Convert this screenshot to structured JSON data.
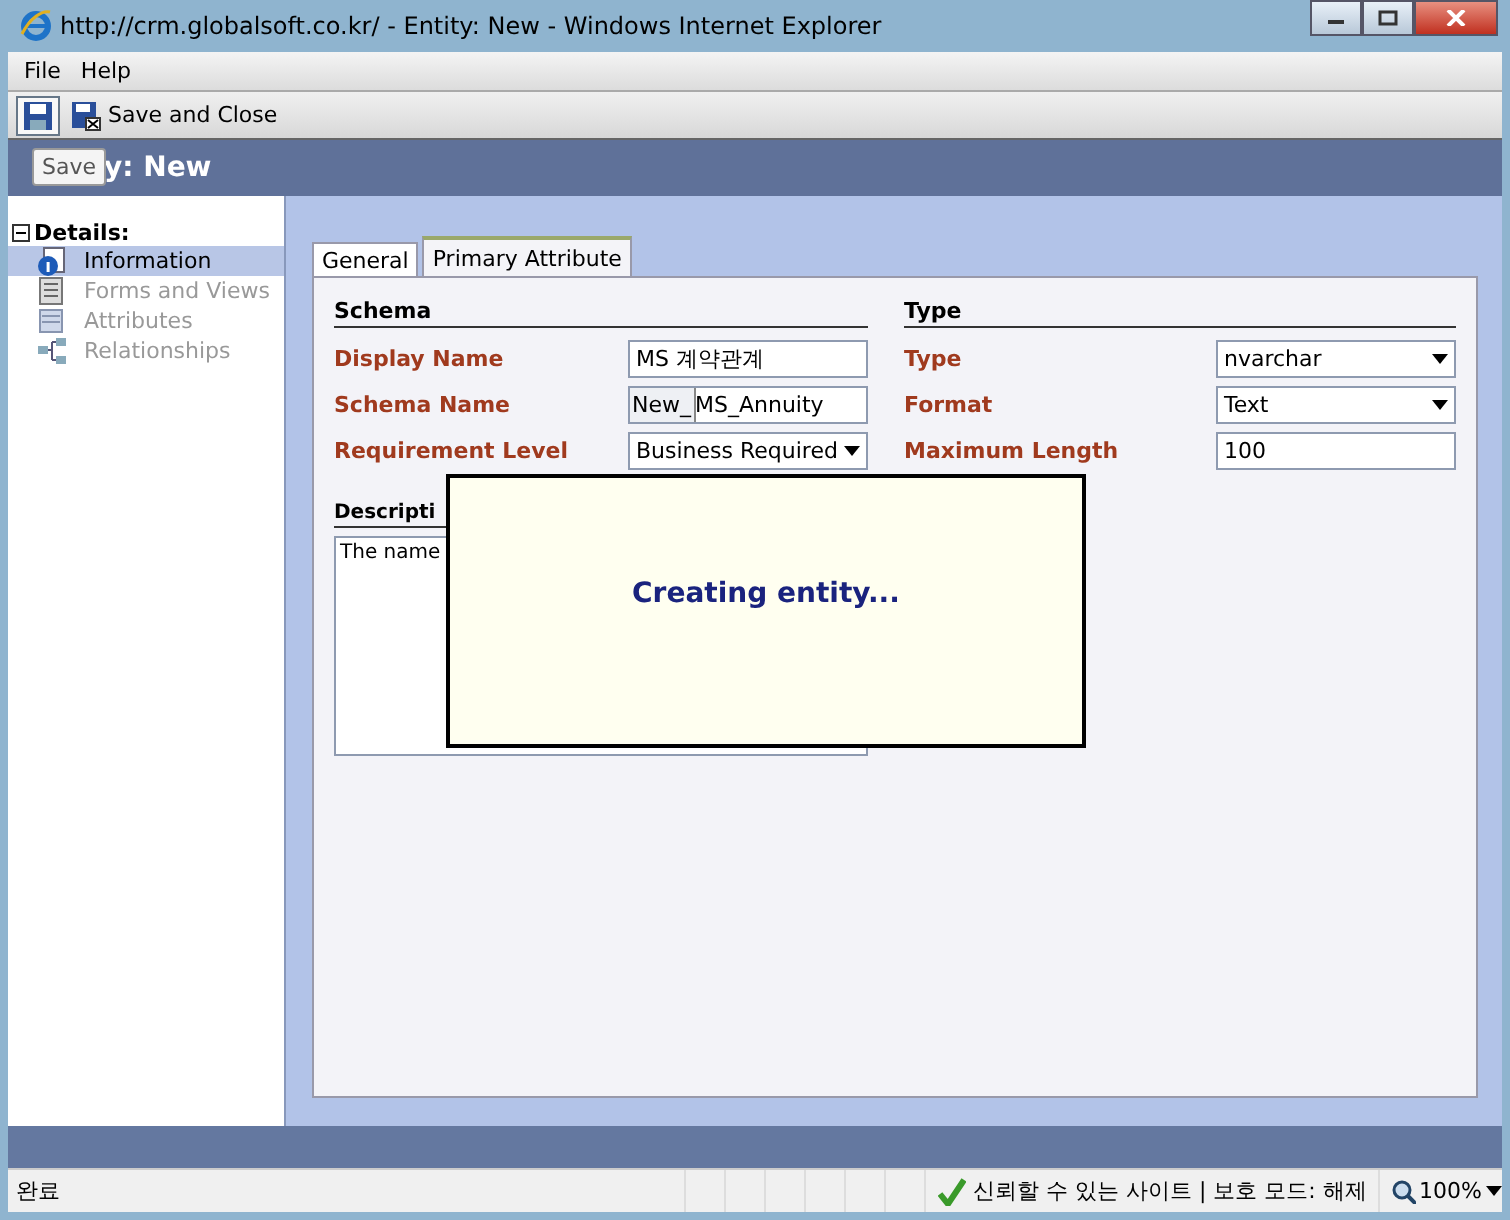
{
  "window": {
    "title": "http://crm.globalsoft.co.kr/ - Entity: New - Windows Internet Explorer"
  },
  "menu": [
    "File",
    "Help"
  ],
  "toolbar": [
    {
      "kind": "save",
      "tooltip": "Save"
    },
    {
      "kind": "save_close",
      "label": "Save and Close"
    }
  ],
  "header": {
    "title": "y: New"
  },
  "sidebar": {
    "heading": "Details:",
    "expanded": true,
    "items": [
      {
        "kind": "info",
        "label": "Information",
        "selected": true,
        "disabled": false
      },
      {
        "kind": "forms",
        "label": "Forms and Views",
        "selected": false,
        "disabled": true
      },
      {
        "kind": "attributes",
        "label": "Attributes",
        "selected": false,
        "disabled": true
      },
      {
        "kind": "relationships",
        "label": "Relationships",
        "selected": false,
        "disabled": true
      }
    ]
  },
  "tabs": [
    {
      "label": "General",
      "selected": false
    },
    {
      "label": "Primary Attribute",
      "selected": true
    }
  ],
  "sections": [
    {
      "title": "Schema",
      "fields": [
        {
          "label": "Display Name",
          "kind": "text",
          "value": "MS 계약관계"
        },
        {
          "label": "Schema Name",
          "kind": "prefixed",
          "prefix": "New_",
          "value": "MS_Annuity"
        },
        {
          "label": "Requirement Level",
          "kind": "select",
          "value": "Business Required"
        }
      ]
    },
    {
      "title": "Type",
      "fields": [
        {
          "label": "Type",
          "kind": "select",
          "value": "nvarchar"
        },
        {
          "label": "Format",
          "kind": "select",
          "value": "Text"
        },
        {
          "label": "Maximum Length",
          "kind": "text",
          "value": "100"
        }
      ]
    }
  ],
  "description": {
    "heading": "Descripti",
    "value": "The name"
  },
  "dialog": {
    "message": "Creating entity..."
  },
  "status_bar": {
    "text": "완료",
    "zone": "신뢰할 수 있는 사이트 | 보호 모드: 해제",
    "zoom": "100%"
  }
}
